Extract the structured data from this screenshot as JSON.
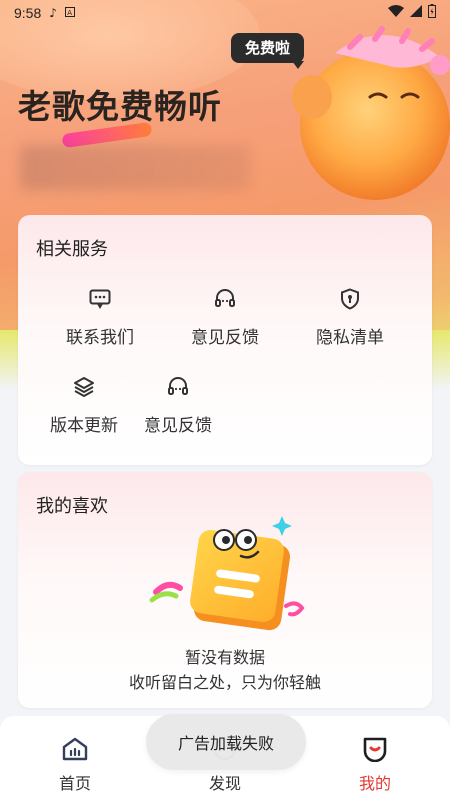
{
  "status_bar": {
    "time": "9:58"
  },
  "hero": {
    "title": "老歌免费畅听",
    "badge": "免费啦"
  },
  "services": {
    "title": "相关服务",
    "items": [
      {
        "label": "联系我们",
        "icon": "chat-icon"
      },
      {
        "label": "意见反馈",
        "icon": "headset-icon"
      },
      {
        "label": "隐私清单",
        "icon": "shield-lock-icon"
      },
      {
        "label": "版本更新",
        "icon": "layers-icon"
      },
      {
        "label": "意见反馈",
        "icon": "headset-icon"
      }
    ]
  },
  "favorites": {
    "title": "我的喜欢",
    "empty_line1": "暂没有数据",
    "empty_line2": "收听留白之处，只为你轻触"
  },
  "tabbar": {
    "tabs": [
      {
        "label": "首页",
        "icon": "home-icon",
        "active": false
      },
      {
        "label": "发现",
        "icon": "discover-icon",
        "active": false
      },
      {
        "label": "我的",
        "icon": "profile-icon",
        "active": true
      }
    ]
  },
  "toast": {
    "message": "广告加载失败"
  },
  "colors": {
    "accent": "#e53935",
    "hero_top": "#fbb487",
    "hero_bottom": "#e9e170"
  }
}
